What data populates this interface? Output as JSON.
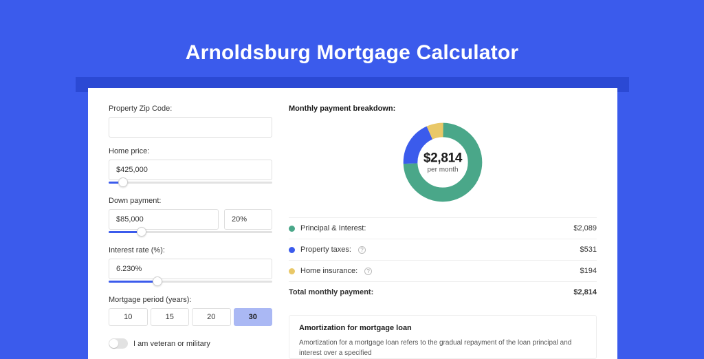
{
  "title": "Arnoldsburg Mortgage Calculator",
  "form": {
    "zip": {
      "label": "Property Zip Code:",
      "value": ""
    },
    "home_price": {
      "label": "Home price:",
      "value": "$425,000",
      "slider_pct": 9
    },
    "down_payment": {
      "label": "Down payment:",
      "value": "$85,000",
      "pct": "20%",
      "slider_pct": 20
    },
    "interest": {
      "label": "Interest rate (%):",
      "value": "6.230%",
      "slider_pct": 30
    },
    "period": {
      "label": "Mortgage period (years):",
      "options": [
        "10",
        "15",
        "20",
        "30"
      ],
      "active": "30"
    },
    "veteran": {
      "label": "I am veteran or military",
      "on": false
    }
  },
  "breakdown": {
    "title": "Monthly payment breakdown:",
    "total_amount": "$2,814",
    "total_sub": "per month",
    "items": [
      {
        "label": "Principal & Interest:",
        "value": "$2,089",
        "color": "green",
        "info": false,
        "num": 2089
      },
      {
        "label": "Property taxes:",
        "value": "$531",
        "color": "blue",
        "info": true,
        "num": 531
      },
      {
        "label": "Home insurance:",
        "value": "$194",
        "color": "yellow",
        "info": true,
        "num": 194
      }
    ],
    "total_row": {
      "label": "Total monthly payment:",
      "value": "$2,814"
    }
  },
  "amort": {
    "title": "Amortization for mortgage loan",
    "text": "Amortization for a mortgage loan refers to the gradual repayment of the loan principal and interest over a specified"
  },
  "chart_data": {
    "type": "pie",
    "title": "Monthly payment breakdown",
    "series": [
      {
        "name": "Principal & Interest",
        "value": 2089,
        "color": "#4aa789"
      },
      {
        "name": "Property taxes",
        "value": 531,
        "color": "#3b5bec"
      },
      {
        "name": "Home insurance",
        "value": 194,
        "color": "#e9c868"
      }
    ],
    "center_label": "$2,814 per month"
  }
}
